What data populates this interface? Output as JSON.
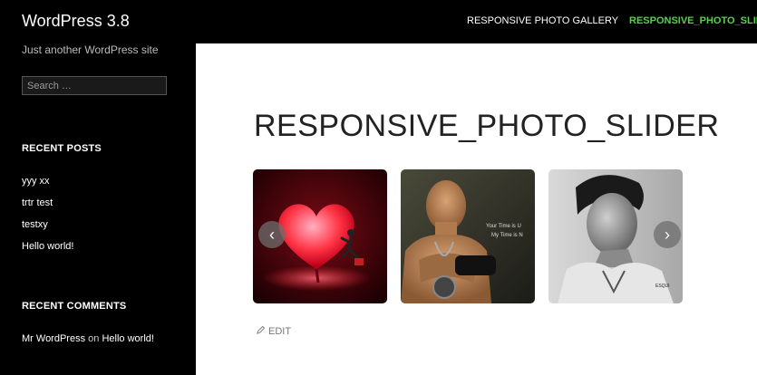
{
  "site": {
    "title": "WordPress 3.8",
    "description": "Just another WordPress site"
  },
  "search": {
    "placeholder": "Search …"
  },
  "widgets": {
    "recent_posts": {
      "title": "RECENT POSTS",
      "items": [
        "yyy xx",
        "trtr test",
        "testxy",
        "Hello world!"
      ]
    },
    "recent_comments": {
      "title": "RECENT COMMENTS",
      "author": "Mr WordPress",
      "on": "on",
      "post": "Hello world!"
    }
  },
  "nav": {
    "items": [
      "RESPONSIVE PHOTO GALLERY",
      "RESPONSIVE_PHOTO_SLIDER"
    ],
    "active_index": 1
  },
  "page": {
    "title": "RESPONSIVE_PHOTO_SLIDER",
    "edit_label": "EDIT"
  },
  "slider": {
    "prev_glyph": "‹",
    "next_glyph": "›",
    "slide2_text": [
      "Your Time is U",
      "My Time is N"
    ]
  },
  "colors": {
    "active_nav": "#55d24a"
  }
}
